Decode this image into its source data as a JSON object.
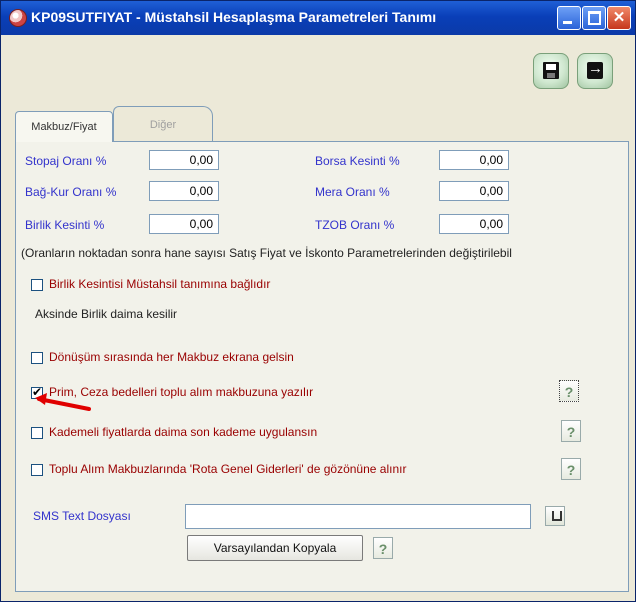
{
  "window": {
    "title": "KP09SUTFIYAT - Müstahsil Hesaplaşma Parametreleri Tanımı",
    "controls": [
      "minimize-icon",
      "maximize-icon",
      "close-icon"
    ]
  },
  "toolbar": {
    "save_icon": "floppy-disk-icon",
    "exit_icon": "exit-icon"
  },
  "tabs": [
    {
      "label": "Makbuz/Fiyat",
      "active": true
    },
    {
      "label": "Diğer",
      "active": false
    }
  ],
  "rates": {
    "stopaj": {
      "label": "Stopaj Oranı %",
      "value": "0,00"
    },
    "bagkur": {
      "label": "Bağ-Kur Oranı %",
      "value": "0,00"
    },
    "birlik": {
      "label": "Birlik Kesinti %",
      "value": "0,00"
    },
    "borsa": {
      "label": "Borsa Kesinti %",
      "value": "0,00"
    },
    "mera": {
      "label": "Mera Oranı %",
      "value": "0,00"
    },
    "tzob": {
      "label": "TZOB Oranı %",
      "value": "0,00"
    }
  },
  "note": "(Oranların noktadan sonra hane sayısı Satış Fiyat ve İskonto Parametrelerinden değiştirilebil",
  "checkboxes": [
    {
      "label": "Birlik Kesintisi Müstahsil tanımına bağlıdır",
      "checked": false
    },
    {
      "label": "Dönüşüm sırasında her Makbuz ekrana gelsin",
      "checked": false
    },
    {
      "label": "Prim, Ceza bedelleri toplu alım makbuzuna yazılır",
      "checked": true
    },
    {
      "label": "Kademeli fiyatlarda daima son kademe uygulansın",
      "checked": false
    },
    {
      "label": "Toplu Alım Makbuzlarında 'Rota Genel Giderleri' de gözönüne alınır",
      "checked": false
    }
  ],
  "sub_note": "Aksinde Birlik daima kesilir",
  "help_label": "?",
  "sms": {
    "label": "SMS Text Dosyası",
    "value": ""
  },
  "copy_button": "Varsayılandan Kopyala",
  "colors": {
    "title_bar": "#0a3fb8",
    "label_blue": "#3333cc",
    "checkbox_red": "#990000",
    "arrow_red": "#e00000"
  }
}
